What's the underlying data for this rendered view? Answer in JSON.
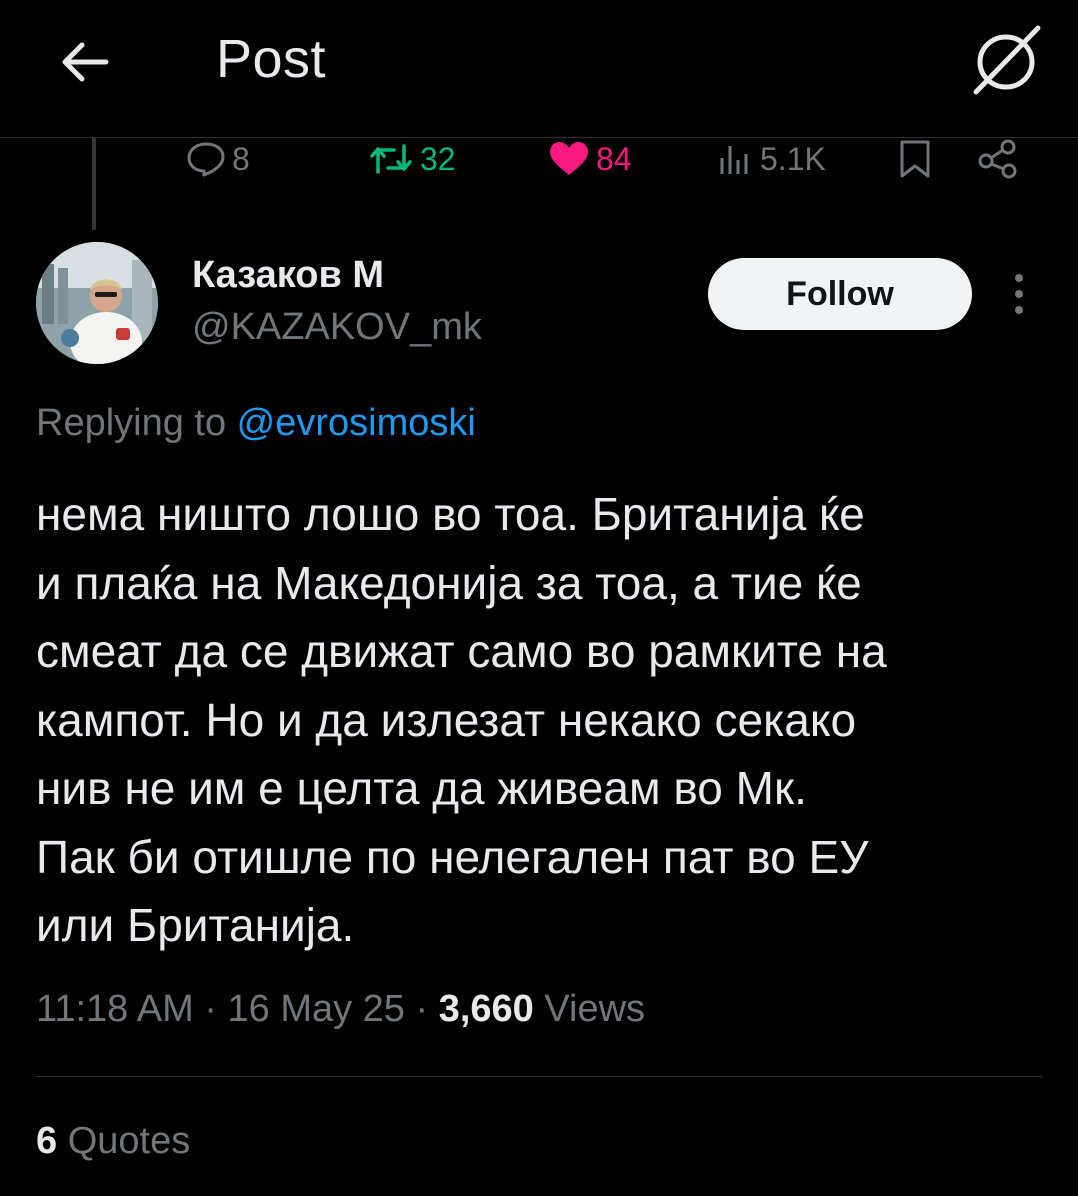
{
  "header": {
    "title": "Post",
    "back_icon": "arrow-left-icon",
    "grok_icon": "grok-icon"
  },
  "actions": {
    "replies": "8",
    "retweets": "32",
    "likes": "84",
    "views": "5.1K",
    "retweet_color": "#00ba7c",
    "like_color": "#f91880"
  },
  "author": {
    "display_name": "Казаков М",
    "handle": "@KAZAKOV_mk",
    "follow_label": "Follow"
  },
  "reply": {
    "prefix": "Replying to ",
    "mention": "@evrosimoski"
  },
  "tweet": {
    "text": "нема ништо лошо во тоа. Британија ќе\nи плаќа на Македонија за тоа, а тие ќе\nсмеат да се движат само во рамките на\nкампот. Но и да излезат некако секако\nнив не им е целта да живеам во Мк.\nПак би отишле по нелегален пат во ЕУ\nили Британија.",
    "timestamp": "11:18 AM · 16 May 25 · ",
    "views_count": "3,660",
    "views_label": " Views"
  },
  "stats": {
    "quotes_count": "6",
    "quotes_label": " Quotes"
  },
  "colors": {
    "background": "#000000",
    "text": "#e7e9ea",
    "muted": "#71767b",
    "link": "#1d9bf0",
    "follow_bg": "#eff3f4"
  }
}
